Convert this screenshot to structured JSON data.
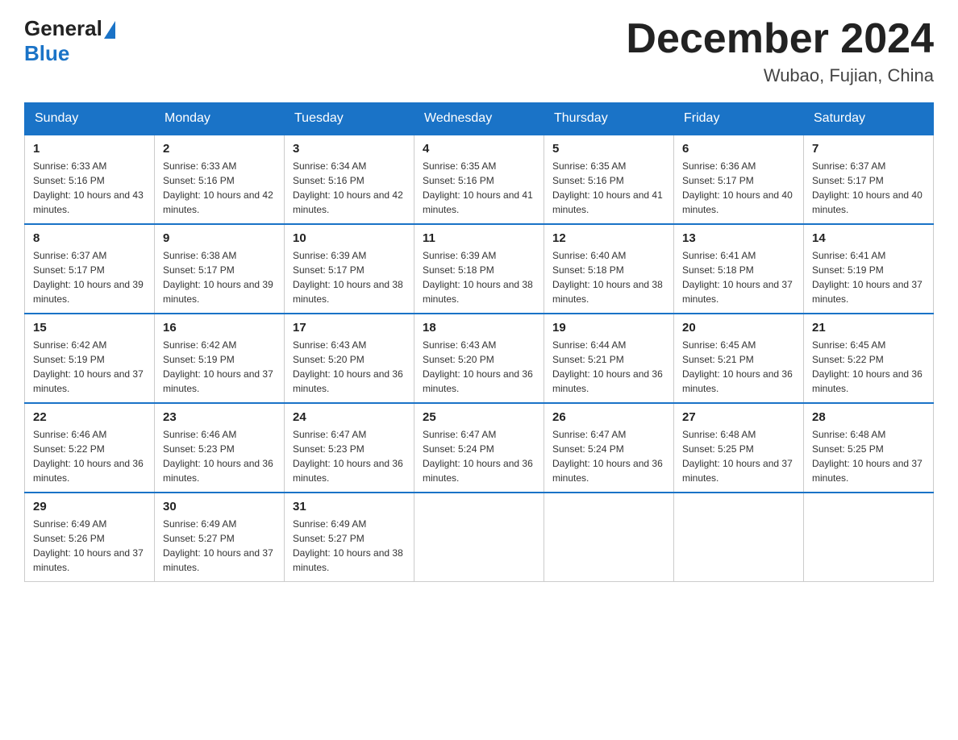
{
  "logo": {
    "general": "General",
    "blue": "Blue"
  },
  "title": "December 2024",
  "location": "Wubao, Fujian, China",
  "days_of_week": [
    "Sunday",
    "Monday",
    "Tuesday",
    "Wednesday",
    "Thursday",
    "Friday",
    "Saturday"
  ],
  "weeks": [
    [
      {
        "day": "1",
        "sunrise": "6:33 AM",
        "sunset": "5:16 PM",
        "daylight": "10 hours and 43 minutes."
      },
      {
        "day": "2",
        "sunrise": "6:33 AM",
        "sunset": "5:16 PM",
        "daylight": "10 hours and 42 minutes."
      },
      {
        "day": "3",
        "sunrise": "6:34 AM",
        "sunset": "5:16 PM",
        "daylight": "10 hours and 42 minutes."
      },
      {
        "day": "4",
        "sunrise": "6:35 AM",
        "sunset": "5:16 PM",
        "daylight": "10 hours and 41 minutes."
      },
      {
        "day": "5",
        "sunrise": "6:35 AM",
        "sunset": "5:16 PM",
        "daylight": "10 hours and 41 minutes."
      },
      {
        "day": "6",
        "sunrise": "6:36 AM",
        "sunset": "5:17 PM",
        "daylight": "10 hours and 40 minutes."
      },
      {
        "day": "7",
        "sunrise": "6:37 AM",
        "sunset": "5:17 PM",
        "daylight": "10 hours and 40 minutes."
      }
    ],
    [
      {
        "day": "8",
        "sunrise": "6:37 AM",
        "sunset": "5:17 PM",
        "daylight": "10 hours and 39 minutes."
      },
      {
        "day": "9",
        "sunrise": "6:38 AM",
        "sunset": "5:17 PM",
        "daylight": "10 hours and 39 minutes."
      },
      {
        "day": "10",
        "sunrise": "6:39 AM",
        "sunset": "5:17 PM",
        "daylight": "10 hours and 38 minutes."
      },
      {
        "day": "11",
        "sunrise": "6:39 AM",
        "sunset": "5:18 PM",
        "daylight": "10 hours and 38 minutes."
      },
      {
        "day": "12",
        "sunrise": "6:40 AM",
        "sunset": "5:18 PM",
        "daylight": "10 hours and 38 minutes."
      },
      {
        "day": "13",
        "sunrise": "6:41 AM",
        "sunset": "5:18 PM",
        "daylight": "10 hours and 37 minutes."
      },
      {
        "day": "14",
        "sunrise": "6:41 AM",
        "sunset": "5:19 PM",
        "daylight": "10 hours and 37 minutes."
      }
    ],
    [
      {
        "day": "15",
        "sunrise": "6:42 AM",
        "sunset": "5:19 PM",
        "daylight": "10 hours and 37 minutes."
      },
      {
        "day": "16",
        "sunrise": "6:42 AM",
        "sunset": "5:19 PM",
        "daylight": "10 hours and 37 minutes."
      },
      {
        "day": "17",
        "sunrise": "6:43 AM",
        "sunset": "5:20 PM",
        "daylight": "10 hours and 36 minutes."
      },
      {
        "day": "18",
        "sunrise": "6:43 AM",
        "sunset": "5:20 PM",
        "daylight": "10 hours and 36 minutes."
      },
      {
        "day": "19",
        "sunrise": "6:44 AM",
        "sunset": "5:21 PM",
        "daylight": "10 hours and 36 minutes."
      },
      {
        "day": "20",
        "sunrise": "6:45 AM",
        "sunset": "5:21 PM",
        "daylight": "10 hours and 36 minutes."
      },
      {
        "day": "21",
        "sunrise": "6:45 AM",
        "sunset": "5:22 PM",
        "daylight": "10 hours and 36 minutes."
      }
    ],
    [
      {
        "day": "22",
        "sunrise": "6:46 AM",
        "sunset": "5:22 PM",
        "daylight": "10 hours and 36 minutes."
      },
      {
        "day": "23",
        "sunrise": "6:46 AM",
        "sunset": "5:23 PM",
        "daylight": "10 hours and 36 minutes."
      },
      {
        "day": "24",
        "sunrise": "6:47 AM",
        "sunset": "5:23 PM",
        "daylight": "10 hours and 36 minutes."
      },
      {
        "day": "25",
        "sunrise": "6:47 AM",
        "sunset": "5:24 PM",
        "daylight": "10 hours and 36 minutes."
      },
      {
        "day": "26",
        "sunrise": "6:47 AM",
        "sunset": "5:24 PM",
        "daylight": "10 hours and 36 minutes."
      },
      {
        "day": "27",
        "sunrise": "6:48 AM",
        "sunset": "5:25 PM",
        "daylight": "10 hours and 37 minutes."
      },
      {
        "day": "28",
        "sunrise": "6:48 AM",
        "sunset": "5:25 PM",
        "daylight": "10 hours and 37 minutes."
      }
    ],
    [
      {
        "day": "29",
        "sunrise": "6:49 AM",
        "sunset": "5:26 PM",
        "daylight": "10 hours and 37 minutes."
      },
      {
        "day": "30",
        "sunrise": "6:49 AM",
        "sunset": "5:27 PM",
        "daylight": "10 hours and 37 minutes."
      },
      {
        "day": "31",
        "sunrise": "6:49 AM",
        "sunset": "5:27 PM",
        "daylight": "10 hours and 38 minutes."
      },
      null,
      null,
      null,
      null
    ]
  ]
}
